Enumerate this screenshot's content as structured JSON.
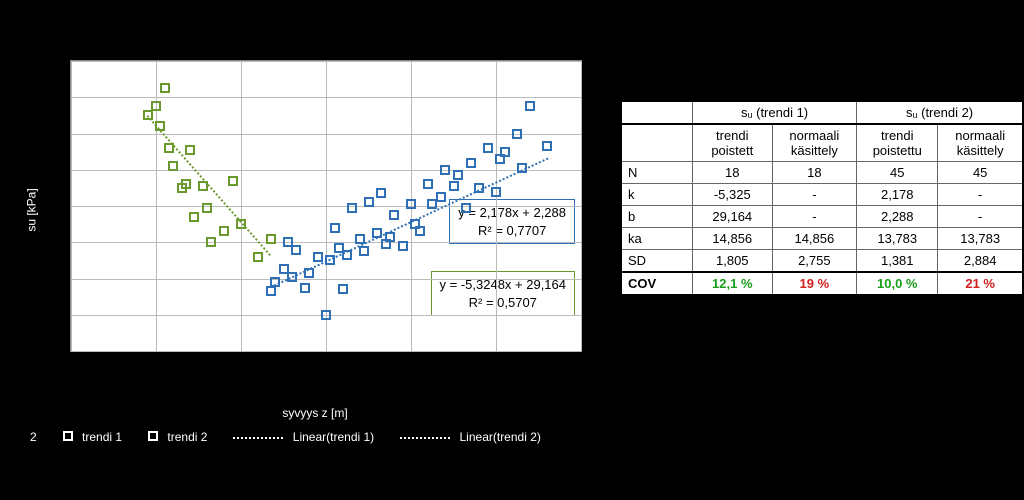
{
  "chart_data": {
    "type": "scatter",
    "xlabel": "syvyys z [m]",
    "ylabel": "su [kPa]",
    "xlim": [
      1,
      7
    ],
    "ylim": [
      6,
      22
    ],
    "grid": true,
    "xticks": [
      1,
      2,
      3,
      4,
      5,
      6,
      7
    ],
    "yticks": [
      6,
      8,
      10,
      12,
      14,
      16,
      18,
      20,
      22
    ],
    "series": [
      {
        "name": "trendi1",
        "legend": "trendi 1",
        "color": "#6a9a2d",
        "marker": "square-open",
        "trend": {
          "slope": -5.3248,
          "intercept": 29.164,
          "r2": 0.5707
        },
        "points": [
          {
            "x": 1.9,
            "y": 19.0
          },
          {
            "x": 2.0,
            "y": 19.5
          },
          {
            "x": 2.05,
            "y": 18.4
          },
          {
            "x": 2.1,
            "y": 20.5
          },
          {
            "x": 2.15,
            "y": 17.2
          },
          {
            "x": 2.2,
            "y": 16.2
          },
          {
            "x": 2.3,
            "y": 15.0
          },
          {
            "x": 2.35,
            "y": 15.2
          },
          {
            "x": 2.4,
            "y": 17.1
          },
          {
            "x": 2.45,
            "y": 13.4
          },
          {
            "x": 2.55,
            "y": 15.1
          },
          {
            "x": 2.6,
            "y": 13.9
          },
          {
            "x": 2.65,
            "y": 12.0
          },
          {
            "x": 2.8,
            "y": 12.6
          },
          {
            "x": 2.9,
            "y": 15.4
          },
          {
            "x": 3.0,
            "y": 13.0
          },
          {
            "x": 3.2,
            "y": 11.2
          },
          {
            "x": 3.35,
            "y": 12.2
          }
        ]
      },
      {
        "name": "trendi2",
        "legend": "trendi 2",
        "color": "#2e6fb5",
        "marker": "square-open",
        "trend": {
          "slope": 2.178,
          "intercept": 2.288,
          "r2": 0.7707
        },
        "points": [
          {
            "x": 3.35,
            "y": 9.3
          },
          {
            "x": 3.4,
            "y": 9.8
          },
          {
            "x": 3.5,
            "y": 10.5
          },
          {
            "x": 3.55,
            "y": 12.0
          },
          {
            "x": 3.6,
            "y": 10.1
          },
          {
            "x": 3.65,
            "y": 11.6
          },
          {
            "x": 3.75,
            "y": 9.5
          },
          {
            "x": 3.8,
            "y": 10.3
          },
          {
            "x": 3.9,
            "y": 11.2
          },
          {
            "x": 4.0,
            "y": 8.0
          },
          {
            "x": 4.05,
            "y": 11.0
          },
          {
            "x": 4.1,
            "y": 12.8
          },
          {
            "x": 4.15,
            "y": 11.7
          },
          {
            "x": 4.2,
            "y": 9.4
          },
          {
            "x": 4.25,
            "y": 11.3
          },
          {
            "x": 4.3,
            "y": 13.9
          },
          {
            "x": 4.4,
            "y": 12.2
          },
          {
            "x": 4.45,
            "y": 11.5
          },
          {
            "x": 4.5,
            "y": 14.2
          },
          {
            "x": 4.6,
            "y": 12.5
          },
          {
            "x": 4.65,
            "y": 14.7
          },
          {
            "x": 4.7,
            "y": 11.9
          },
          {
            "x": 4.75,
            "y": 12.3
          },
          {
            "x": 4.8,
            "y": 13.5
          },
          {
            "x": 4.9,
            "y": 11.8
          },
          {
            "x": 5.0,
            "y": 14.1
          },
          {
            "x": 5.05,
            "y": 13.0
          },
          {
            "x": 5.1,
            "y": 12.6
          },
          {
            "x": 5.2,
            "y": 15.2
          },
          {
            "x": 5.25,
            "y": 14.1
          },
          {
            "x": 5.35,
            "y": 14.5
          },
          {
            "x": 5.4,
            "y": 16.0
          },
          {
            "x": 5.5,
            "y": 15.1
          },
          {
            "x": 5.55,
            "y": 15.7
          },
          {
            "x": 5.65,
            "y": 13.9
          },
          {
            "x": 5.7,
            "y": 16.4
          },
          {
            "x": 5.8,
            "y": 15.0
          },
          {
            "x": 5.9,
            "y": 17.2
          },
          {
            "x": 6.0,
            "y": 14.8
          },
          {
            "x": 6.05,
            "y": 16.6
          },
          {
            "x": 6.1,
            "y": 17.0
          },
          {
            "x": 6.25,
            "y": 18.0
          },
          {
            "x": 6.3,
            "y": 16.1
          },
          {
            "x": 6.4,
            "y": 19.5
          },
          {
            "x": 6.6,
            "y": 17.3
          }
        ]
      }
    ],
    "annotations": [
      {
        "series": "trendi2",
        "text_line1": "y = 2,178x + 2,288",
        "text_line2": "R² = 0,7707"
      },
      {
        "series": "trendi1",
        "text_line1": "y = -5,3248x + 29,164",
        "text_line2": "R² = 0,5707"
      }
    ],
    "legend_trends": [
      "Linear(trendi 1)",
      "Linear(trendi 2)"
    ]
  },
  "legend_prefix": "2",
  "table": {
    "group_headers": [
      "sᵤ (trendi 1)",
      "sᵤ (trendi 2)"
    ],
    "sub_headers": [
      [
        "trendi poistett",
        "normaali käsittely"
      ],
      [
        "trendi poistettu",
        "normaali käsittely"
      ]
    ],
    "rows": [
      {
        "label": "N",
        "cells": [
          "18",
          "18",
          "45",
          "45"
        ]
      },
      {
        "label": "k",
        "cells": [
          "-5,325",
          "-",
          "2,178",
          "-"
        ]
      },
      {
        "label": "b",
        "cells": [
          "29,164",
          "-",
          "2,288",
          "-"
        ]
      },
      {
        "label": "ka",
        "cells": [
          "14,856",
          "14,856",
          "13,783",
          "13,783"
        ]
      },
      {
        "label": "SD",
        "cells": [
          "1,805",
          "2,755",
          "1,381",
          "2,884"
        ]
      }
    ],
    "cov": {
      "label": "COV",
      "cells": [
        "12,1 %",
        "19 %",
        "10,0 %",
        "21 %"
      ]
    }
  }
}
